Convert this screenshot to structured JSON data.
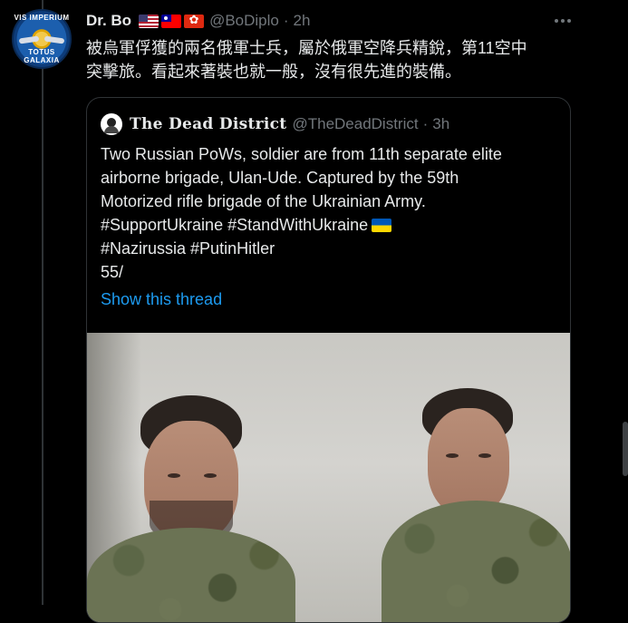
{
  "tweet": {
    "author_name": "Dr. Bo",
    "handle": "@BoDiplo",
    "separator": "·",
    "time": "2h",
    "flags": [
      "us-flag",
      "tw-flag",
      "hk-flag"
    ],
    "avatar_text_top": "VIS IMPERIUM",
    "avatar_text_bottom": "TOTUS GALAXIA",
    "text_line1": "被烏軍俘獲的兩名俄軍士兵，屬於俄軍空降兵精銳，第11空中",
    "text_line2": "突擊旅。看起來著裝也就一般，沒有很先進的裝備。"
  },
  "quoted": {
    "author_name": "The Dead District",
    "handle": "@TheDeadDistrict",
    "separator": "·",
    "time": "3h",
    "lines": [
      "Two Russian PoWs, soldier are from 11th separate elite",
      "airborne brigade, Ulan-Ude. Captured by the 59th",
      "Motorized rifle brigade of the Ukrainian Army.",
      "#SupportUkraine #StandWithUkraine",
      "#Nazirussia #PutinHitler",
      "55/"
    ],
    "show_thread": "Show this thread"
  },
  "colors": {
    "background": "#000000",
    "text": "#e7e9ea",
    "muted": "#71767b",
    "link": "#1d9bf0",
    "border": "#2f3336"
  }
}
